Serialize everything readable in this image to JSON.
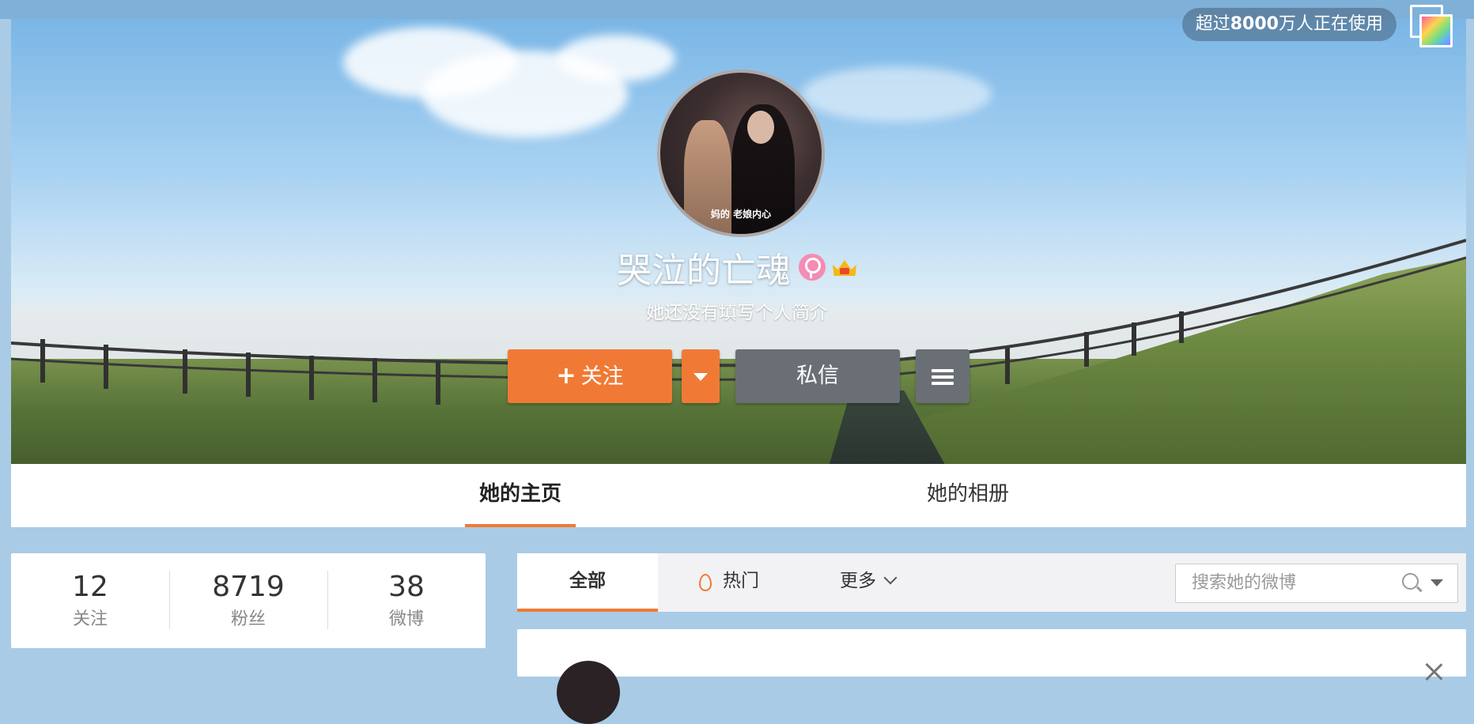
{
  "header": {
    "users_badge_prefix": "超过",
    "users_badge_count": "8000",
    "users_badge_suffix": "万人正在使用"
  },
  "profile": {
    "name": "哭泣的亡魂",
    "intro": "她还没有填写个人简介",
    "avatar_caption": "妈的 老娘内心",
    "gender_icon": "female-icon",
    "vip_icon": "crown-icon"
  },
  "actions": {
    "follow_plus": "+",
    "follow_label": "关注",
    "message_label": "私信"
  },
  "tabs": [
    {
      "label": "她的主页",
      "active": true
    },
    {
      "label": "她的相册",
      "active": false
    }
  ],
  "stats": [
    {
      "value": "12",
      "label": "关注"
    },
    {
      "value": "8719",
      "label": "粉丝"
    },
    {
      "value": "38",
      "label": "微博"
    }
  ],
  "feed": {
    "tab_all": "全部",
    "tab_hot": "热门",
    "tab_more": "更多",
    "search_placeholder": "搜索她的微博"
  },
  "colors": {
    "accent": "#f07a35",
    "button_gray": "#6a6f76"
  }
}
